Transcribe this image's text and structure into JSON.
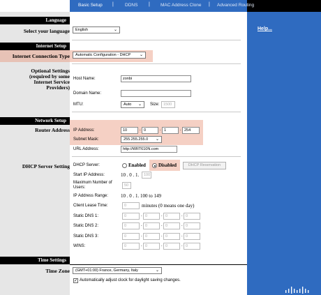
{
  "tabs": [
    {
      "label": "Basic Setup"
    },
    {
      "label": "DDNS"
    },
    {
      "label": "MAC Address Clone"
    },
    {
      "label": "Advanced Routing"
    }
  ],
  "tab_separator": "|",
  "help_link": "Help...",
  "sections": {
    "language": "Language",
    "internet_setup": "Internet Setup",
    "network_setup": "Network Setup",
    "time_settings": "Time Settings"
  },
  "left_labels": {
    "select_language": "Select your language",
    "internet_connection_type": "Internet Connection Type",
    "optional_settings": [
      "Optional Settings",
      "(required by some",
      "Internet Service",
      "Providers)"
    ],
    "router_address": "Router Address",
    "dhcp_server_setting": "DHCP Server Setting",
    "time_zone": "Time Zone"
  },
  "language_select": "English",
  "connection_type_select": "Automatic Configuration - DHCP",
  "host_name": {
    "label": "Host Name:",
    "value": "zonbi"
  },
  "domain_name": {
    "label": "Domain Name:",
    "value": ""
  },
  "mtu": {
    "label": "MTU:",
    "select": "Auto",
    "size_label": "Size:",
    "size_value": "1500"
  },
  "ip_address": {
    "label": "IP Address:",
    "octets": [
      "10",
      "0",
      "1",
      "254"
    ]
  },
  "subnet_mask": {
    "label": "Subnet Mask:",
    "value": "255.255.255.0"
  },
  "url_address": {
    "label": "URL Address:",
    "value": "http://WRT610N.com"
  },
  "dhcp": {
    "server_label": "DHCP Server:",
    "enabled_label": "Enabled",
    "disabled_label": "Disabled",
    "selected": "Disabled",
    "reservation_button": "DHCP Reservation",
    "start_ip_label": "Start IP  Address:",
    "start_ip_prefix": "10 . 0 . 1.",
    "start_ip_value": "100",
    "max_users_label": [
      "Maximum Number of",
      "Users:"
    ],
    "max_users_value": "50",
    "ip_range_label": "IP Address Range:",
    "ip_range_value": "10 . 0 . 1. 100 to 149",
    "lease_label": "Client Lease Time:",
    "lease_value": "0",
    "lease_unit": "minutes (0 means one day)",
    "dns1_label": "Static DNS 1:",
    "dns2_label": "Static DNS 2:",
    "dns3_label": "Static DNS 3:",
    "wins_label": "WINS:",
    "zero": "0"
  },
  "time_zone_select": "(GMT+01:00) France, Germany, Italy",
  "daylight_checkbox": {
    "checked": true,
    "label": "Automatically adjust clock for daylight saving changes."
  },
  "colors": {
    "brand_blue": "#2f6bc0",
    "highlight": "#e8967d"
  }
}
